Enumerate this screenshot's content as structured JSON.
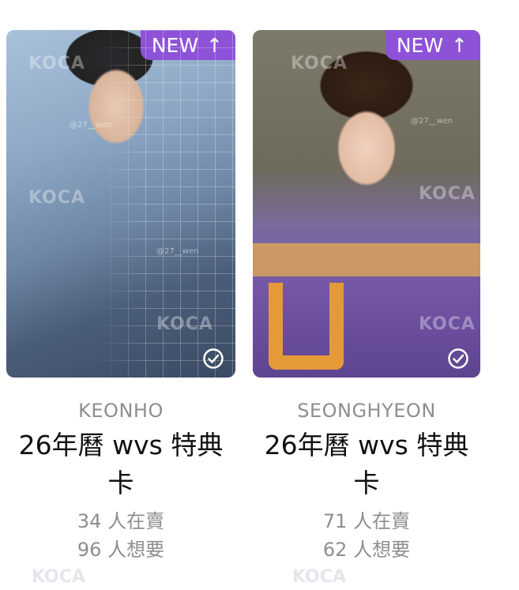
{
  "cards": [
    {
      "badge": {
        "label": "NEW",
        "arrow": "↑"
      },
      "watermark": "KOCA",
      "watermark_user": "@27__wen",
      "member": "KEONHO",
      "title": "26年曆 wvs 特典卡",
      "selling": "34 人在賣",
      "wanting": "96 人想要",
      "icons": [
        "arrow-up-icon",
        "check-circle-icon"
      ]
    },
    {
      "badge": {
        "label": "NEW",
        "arrow": "↑"
      },
      "watermark": "KOCA",
      "watermark_user": "@27__wen",
      "member": "SEONGHYEON",
      "title": "26年曆 wvs 特典卡",
      "selling": "71 人在賣",
      "wanting": "62 人想要",
      "icons": [
        "arrow-up-icon",
        "check-circle-icon"
      ]
    }
  ],
  "colors": {
    "badge": "#8d52d8",
    "muted_text": "#8e8e8e",
    "title_text": "#111111"
  }
}
